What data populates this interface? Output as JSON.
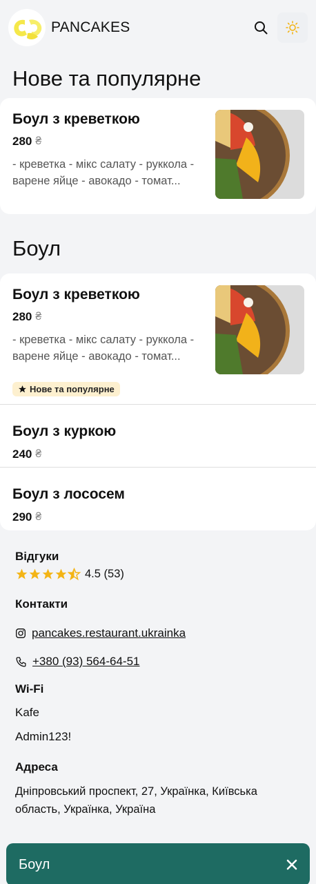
{
  "header": {
    "brand": "PANCAKES",
    "icons": [
      "search-icon",
      "sun-icon"
    ],
    "accent": "#f3b415"
  },
  "sections": {
    "popular_title": "Нове та популярне",
    "bowl_title": "Боул"
  },
  "popular_item": {
    "name": "Боул з креветкою",
    "price": "280",
    "currency": "₴",
    "description": "- креветка - мікс салату - руккола - варене яйце - авокадо - томат..."
  },
  "bowl_items": [
    {
      "name": "Боул з креветкою",
      "price": "280",
      "currency": "₴",
      "description": "- креветка - мікс салату - руккола - варене яйце - авокадо - томат...",
      "badge": "Нове та популярне"
    },
    {
      "name": "Боул з куркою",
      "price": "240",
      "currency": "₴"
    },
    {
      "name": "Боул з лососем",
      "price": "290",
      "currency": "₴"
    }
  ],
  "info": {
    "reviews_title": "Відгуки",
    "rating_text": "4.5 (53)",
    "rating_value": 4.5,
    "contacts_title": "Контакти",
    "instagram": "pancakes.restaurant.ukrainka",
    "phone": "+380 (93) 564-64-51",
    "wifi_title": "Wi-Fi",
    "wifi_name": "Kafe",
    "wifi_password": "Admin123!",
    "address_title": "Адреса",
    "address": "Дніпровський проспект, 27, Українка, Київська область, Українка, Україна"
  },
  "bottom_bar": {
    "label": "Боул",
    "color": "#1e6b62"
  }
}
